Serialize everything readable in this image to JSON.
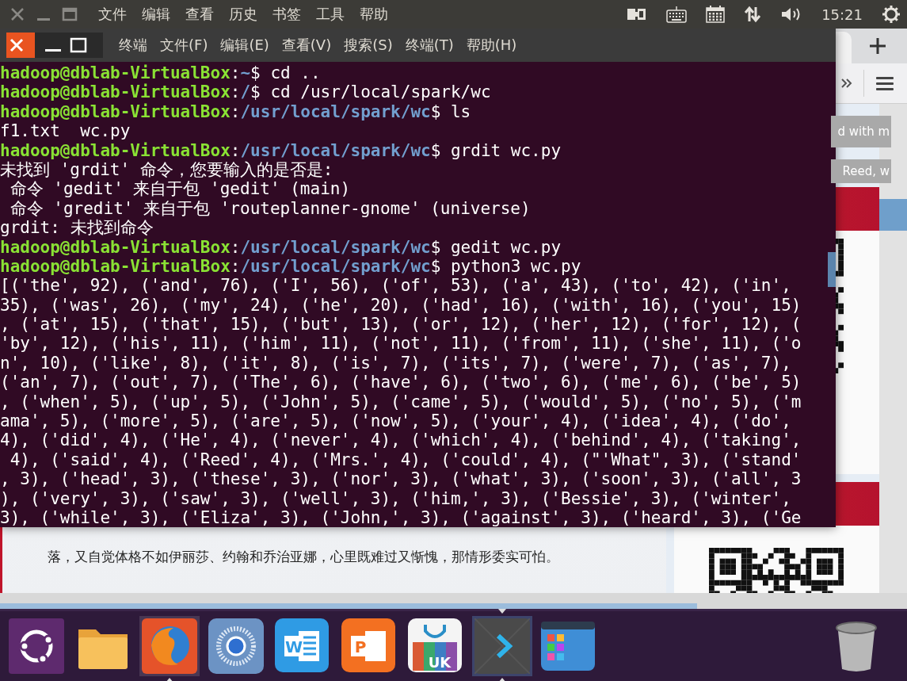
{
  "top_panel": {
    "menu": [
      "文件",
      "编辑",
      "查看",
      "历史",
      "书签",
      "工具",
      "帮助"
    ],
    "clock": "15:21"
  },
  "browser": {
    "highlights": [
      "d with m",
      "Reed, w"
    ],
    "paragraph": "落，又自觉体格不如伊丽莎、约翰和乔治亚娜，心里既难过又惭愧，那情形委实可怕。"
  },
  "terminal": {
    "menu": [
      "终端",
      "文件(F)",
      "编辑(E)",
      "查看(V)",
      "搜索(S)",
      "终端(T)",
      "帮助(H)"
    ],
    "lines": [
      {
        "kind": "prompt",
        "user": "hadoop@dblab-VirtualBox",
        "sep": ":",
        "path": "~",
        "tail": "$ cd .."
      },
      {
        "kind": "prompt",
        "user": "hadoop@dblab-VirtualBox",
        "sep": ":",
        "path": "/",
        "tail": "$ cd /usr/local/spark/wc"
      },
      {
        "kind": "prompt",
        "user": "hadoop@dblab-VirtualBox",
        "sep": ":",
        "path": "/usr/local/spark/wc",
        "tail": "$ ls"
      },
      {
        "kind": "output",
        "text": "f1.txt  wc.py"
      },
      {
        "kind": "prompt",
        "user": "hadoop@dblab-VirtualBox",
        "sep": ":",
        "path": "/usr/local/spark/wc",
        "tail": "$ grdit wc.py"
      },
      {
        "kind": "output",
        "text": "未找到 'grdit' 命令，您要输入的是否是:"
      },
      {
        "kind": "output",
        "text": " 命令 'gedit' 来自于包 'gedit' (main)"
      },
      {
        "kind": "output",
        "text": " 命令 'gredit' 来自于包 'routeplanner-gnome' (universe)"
      },
      {
        "kind": "output",
        "text": "grdit: 未找到命令"
      },
      {
        "kind": "prompt",
        "user": "hadoop@dblab-VirtualBox",
        "sep": ":",
        "path": "/usr/local/spark/wc",
        "tail": "$ gedit wc.py"
      },
      {
        "kind": "prompt",
        "user": "hadoop@dblab-VirtualBox",
        "sep": ":",
        "path": "/usr/local/spark/wc",
        "tail": "$ python3 wc.py"
      },
      {
        "kind": "output",
        "text": "[('the', 92), ('and', 76), ('I', 56), ('of', 53), ('a', 43), ('to', 42), ('in',"
      },
      {
        "kind": "output",
        "text": "35), ('was', 26), ('my', 24), ('he', 20), ('had', 16), ('with', 16), ('you', 15)"
      },
      {
        "kind": "output",
        "text": ", ('at', 15), ('that', 15), ('but', 13), ('or', 12), ('her', 12), ('for', 12), ("
      },
      {
        "kind": "output",
        "text": "'by', 12), ('his', 11), ('him', 11), ('not', 11), ('from', 11), ('she', 11), ('o"
      },
      {
        "kind": "output",
        "text": "n', 10), ('like', 8), ('it', 8), ('is', 7), ('its', 7), ('were', 7), ('as', 7),"
      },
      {
        "kind": "output",
        "text": "('an', 7), ('out', 7), ('The', 6), ('have', 6), ('two', 6), ('me', 6), ('be', 5)"
      },
      {
        "kind": "output",
        "text": ", ('when', 5), ('up', 5), ('John', 5), ('came', 5), ('would', 5), ('no', 5), ('m"
      },
      {
        "kind": "output",
        "text": "ama', 5), ('more', 5), ('are', 5), ('now', 5), ('your', 4), ('idea', 4), ('do',"
      },
      {
        "kind": "output",
        "text": "4), ('did', 4), ('He', 4), ('never', 4), ('which', 4), ('behind', 4), ('taking',"
      },
      {
        "kind": "output",
        "text": " 4), ('said', 4), ('Reed', 4), ('Mrs.', 4), ('could', 4), (\"'What\", 3), ('stand'"
      },
      {
        "kind": "output",
        "text": ", 3), ('head', 3), ('these', 3), ('nor', 3), ('what', 3), ('soon', 3), ('all', 3"
      },
      {
        "kind": "output",
        "text": "), ('very', 3), ('saw', 3), ('well', 3), ('him,', 3), ('Bessie', 3), ('winter',"
      },
      {
        "kind": "output",
        "text": "3), ('while', 3), ('Eliza', 3), ('John,', 3), ('against', 3), ('heard', 3), ('Ge"
      }
    ]
  },
  "dock": {
    "items": [
      {
        "running": false,
        "focused": false
      },
      {
        "running": false,
        "focused": false
      },
      {
        "running": true,
        "focused": false
      },
      {
        "running": false,
        "focused": false
      },
      {
        "running": false,
        "focused": false,
        "letter": "W"
      },
      {
        "running": false,
        "focused": false,
        "letter": "P"
      },
      {
        "running": false,
        "focused": false,
        "letter": "UK"
      },
      {
        "running": true,
        "focused": true
      },
      {
        "running": false,
        "focused": false
      }
    ],
    "trash": {
      "running": false
    }
  }
}
